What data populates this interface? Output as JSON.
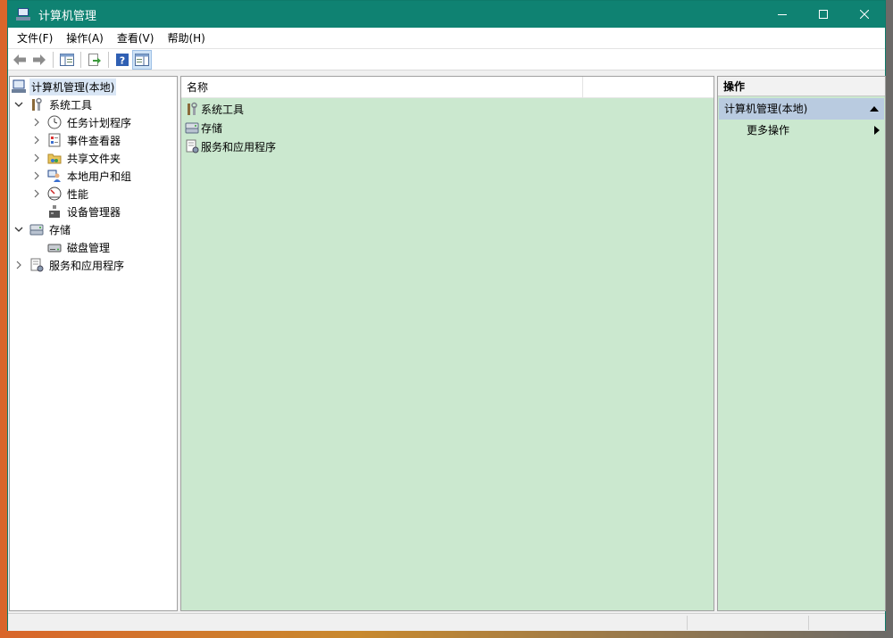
{
  "window": {
    "title": "计算机管理"
  },
  "menu": [
    "文件(F)",
    "操作(A)",
    "查看(V)",
    "帮助(H)"
  ],
  "toolbar": {
    "buttons": [
      "back-arrow-icon",
      "forward-arrow-icon",
      "show-hide-console-tree-icon",
      "export-list-icon",
      "help-icon",
      "show-hide-action-pane-icon"
    ]
  },
  "tree": {
    "root": "计算机管理(本地)",
    "system_tools": "系统工具",
    "task_scheduler": "任务计划程序",
    "event_viewer": "事件查看器",
    "shared_folders": "共享文件夹",
    "local_users": "本地用户和组",
    "performance": "性能",
    "device_manager": "设备管理器",
    "storage": "存储",
    "disk_management": "磁盘管理",
    "services_apps": "服务和应用程序"
  },
  "list": {
    "column_name": "名称",
    "items": [
      "系统工具",
      "存储",
      "服务和应用程序"
    ]
  },
  "actions": {
    "header": "操作",
    "group": "计算机管理(本地)",
    "more": "更多操作"
  },
  "colors": {
    "titlebar": "#0f8272",
    "pane_bg": "#cbe8cf",
    "selected_group": "#b9cbe0"
  }
}
